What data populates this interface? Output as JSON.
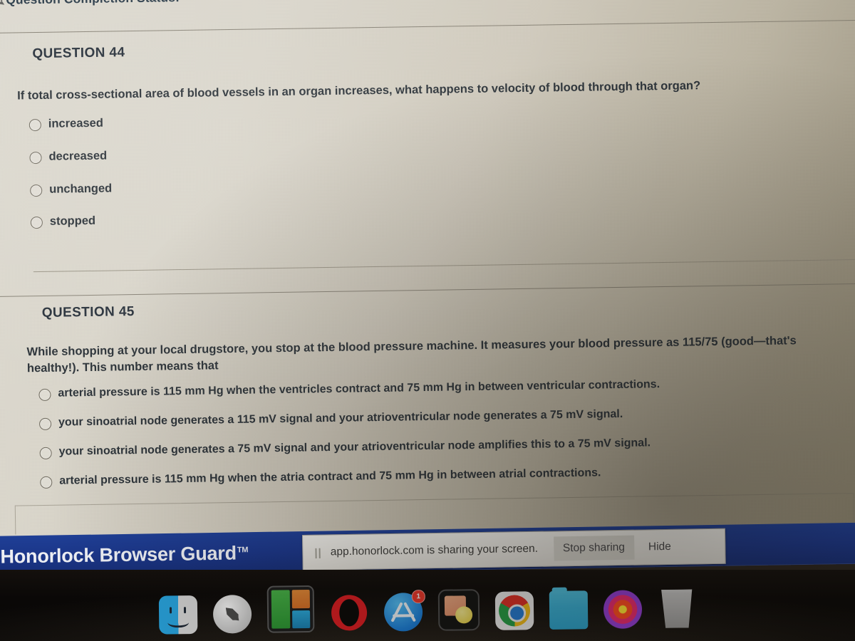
{
  "status": {
    "label": "Question Completion Status:"
  },
  "questions": [
    {
      "heading": "QUESTION 44",
      "text": "If total cross-sectional area of blood vessels in an organ increases, what happens to velocity of blood through that organ?",
      "options": [
        "increased",
        "decreased",
        "unchanged",
        "stopped"
      ]
    },
    {
      "heading": "QUESTION 45",
      "text": "While shopping at your local drugstore, you stop at the blood pressure machine. It measures your blood pressure as 115/75 (good—that's healthy!). This number means that",
      "options": [
        "arterial pressure is 115 mm Hg when the ventricles contract and 75 mm Hg in between ventricular contractions.",
        "your sinoatrial node generates a 115 mV signal and your atrioventricular node generates a 75 mV signal.",
        "your sinoatrial node generates a 75 mV signal and your atrioventricular node amplifies this to a 75 mV signal.",
        "arterial pressure is 115 mm Hg when the atria contract and 75 mm Hg in between atrial contractions."
      ]
    }
  ],
  "honorlock": {
    "title": "Honorlock Browser Guard",
    "trademark": "TM",
    "bar_color": "#1b3689"
  },
  "screen_share": {
    "pause_glyph": "||",
    "message": "app.honorlock.com is sharing your screen.",
    "stop_label": "Stop sharing",
    "hide_label": "Hide"
  },
  "dock": {
    "items": [
      {
        "name": "finder-icon",
        "label": "Finder",
        "badge": ""
      },
      {
        "name": "launchpad-icon",
        "label": "Launchpad",
        "badge": ""
      },
      {
        "name": "mission-control-icon",
        "label": "Mission Control",
        "badge": ""
      },
      {
        "name": "opera-icon",
        "label": "Opera",
        "badge": ""
      },
      {
        "name": "app-store-icon",
        "label": "App Store",
        "badge": "1"
      },
      {
        "name": "preview-icon",
        "label": "Preview",
        "badge": ""
      },
      {
        "name": "chrome-icon",
        "label": "Google Chrome",
        "badge": ""
      },
      {
        "name": "folder-icon",
        "label": "Downloads",
        "badge": ""
      },
      {
        "name": "photos-icon",
        "label": "Photos",
        "badge": ""
      },
      {
        "name": "trash-icon",
        "label": "Trash",
        "badge": ""
      }
    ]
  }
}
